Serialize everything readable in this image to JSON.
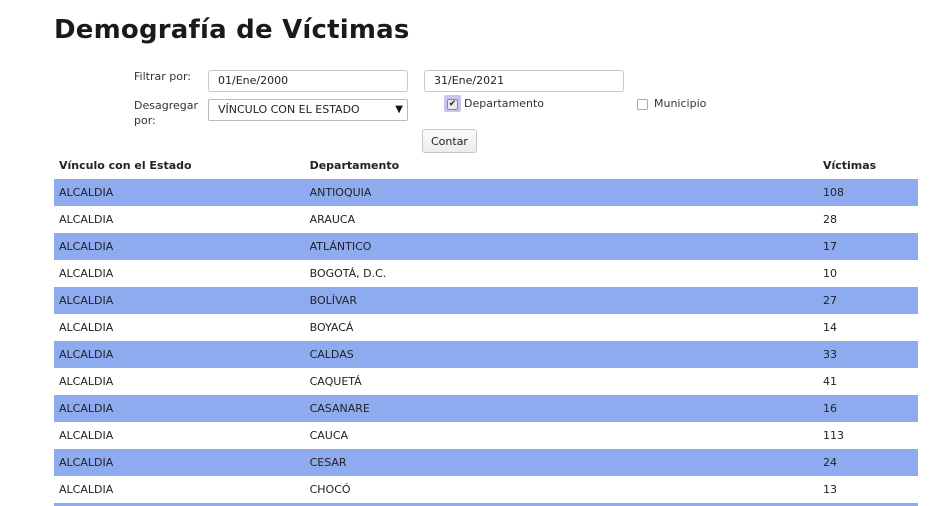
{
  "title": "Demografía de Víctimas",
  "filters": {
    "filter_label": "Filtrar por:",
    "date_from": "01/Ene/2000",
    "date_to": "31/Ene/2021",
    "disaggregate_label_line1": "Desagregar",
    "disaggregate_label_line2": "por:",
    "disaggregate_value": "VÍNCULO CON EL ESTADO",
    "checkbox_departamento": "Departamento",
    "checkbox_departamento_checked": true,
    "checkbox_municipio": "Municipio",
    "checkbox_municipio_checked": false,
    "count_button": "Contar"
  },
  "table": {
    "headers": [
      "Vínculo con el Estado",
      "Departamento",
      "Víctimas"
    ],
    "rows": [
      [
        "ALCALDIA",
        "ANTIOQUIA",
        "108"
      ],
      [
        "ALCALDIA",
        "ARAUCA",
        "28"
      ],
      [
        "ALCALDIA",
        "ATLÁNTICO",
        "17"
      ],
      [
        "ALCALDIA",
        "BOGOTÁ, D.C.",
        "10"
      ],
      [
        "ALCALDIA",
        "BOLÍVAR",
        "27"
      ],
      [
        "ALCALDIA",
        "BOYACÁ",
        "14"
      ],
      [
        "ALCALDIA",
        "CALDAS",
        "33"
      ],
      [
        "ALCALDIA",
        "CAQUETÁ",
        "41"
      ],
      [
        "ALCALDIA",
        "CASANARE",
        "16"
      ],
      [
        "ALCALDIA",
        "CAUCA",
        "113"
      ],
      [
        "ALCALDIA",
        "CESAR",
        "24"
      ],
      [
        "ALCALDIA",
        "CHOCÓ",
        "13"
      ]
    ]
  },
  "colors": {
    "row_highlight": "#8fabf0",
    "checkbox_focus": "#c9c4ef"
  },
  "icons": {
    "select_arrow": "triangle-down-icon",
    "checkmark": "checkmark-icon"
  }
}
